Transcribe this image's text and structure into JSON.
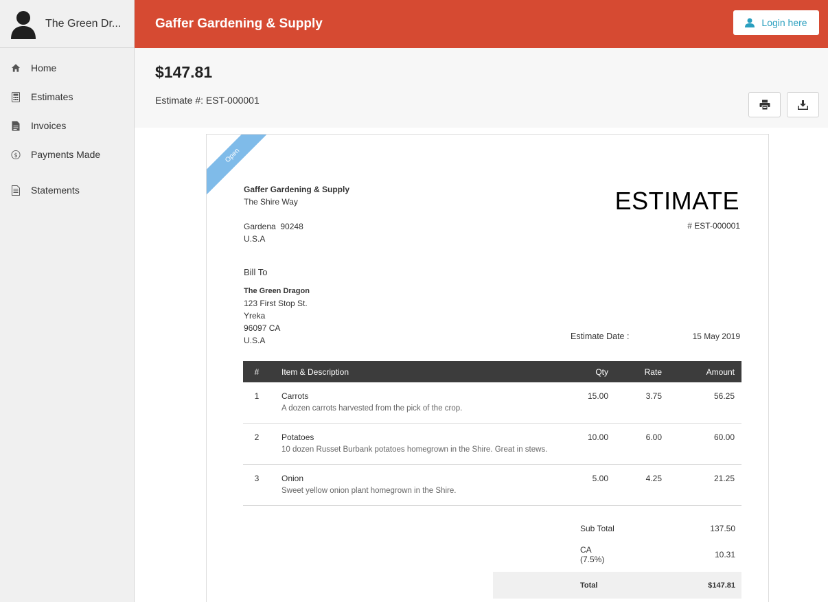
{
  "sidebar": {
    "org_name": "The Green Dr...",
    "items": [
      {
        "label": "Home",
        "icon": "home-icon"
      },
      {
        "label": "Estimates",
        "icon": "calculator-icon"
      },
      {
        "label": "Invoices",
        "icon": "document-icon"
      },
      {
        "label": "Payments Made",
        "icon": "dollar-circle-icon"
      },
      {
        "label": "Statements",
        "icon": "statement-icon"
      }
    ]
  },
  "header": {
    "brand": "Gaffer Gardening & Supply",
    "login_label": "Login here"
  },
  "summary": {
    "amount": "$147.81",
    "estimate_number_label": "Estimate #: EST-000001"
  },
  "document": {
    "status_ribbon": "Open",
    "title": "ESTIMATE",
    "number": "# EST-000001",
    "from": {
      "name": "Gaffer Gardening & Supply",
      "street": "The Shire Way",
      "city_zip": "Gardena  90248",
      "country": "U.S.A"
    },
    "bill_to_label": "Bill To",
    "bill_to": {
      "name": "The Green Dragon",
      "street": "123 First Stop St.",
      "city": "Yreka",
      "zip_state": "96097 CA",
      "country": "U.S.A"
    },
    "date_label": "Estimate Date :",
    "date_value": "15 May 2019",
    "table": {
      "headers": {
        "num": "#",
        "item": "Item & Description",
        "qty": "Qty",
        "rate": "Rate",
        "amount": "Amount"
      },
      "rows": [
        {
          "num": "1",
          "name": "Carrots",
          "desc": "A dozen carrots harvested from the pick of the crop.",
          "qty": "15.00",
          "rate": "3.75",
          "amount": "56.25"
        },
        {
          "num": "2",
          "name": "Potatoes",
          "desc": "10 dozen Russet Burbank potatoes homegrown in the Shire. Great in stews.",
          "qty": "10.00",
          "rate": "6.00",
          "amount": "60.00"
        },
        {
          "num": "3",
          "name": "Onion",
          "desc": "Sweet yellow onion plant homegrown in the Shire.",
          "qty": "5.00",
          "rate": "4.25",
          "amount": "21.25"
        }
      ]
    },
    "totals": {
      "subtotal_label": "Sub Total",
      "subtotal": "137.50",
      "tax_label": "CA (7.5%)",
      "tax": "10.31",
      "total_label": "Total",
      "total": "$147.81"
    }
  },
  "colors": {
    "header_bg": "#d64a32",
    "ribbon": "#7fbbe9",
    "table_header": "#3c3c3c",
    "login_text": "#2a9fbf"
  }
}
